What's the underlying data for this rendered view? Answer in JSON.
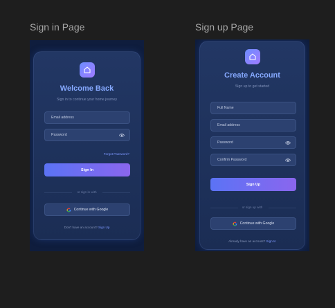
{
  "signin": {
    "frame_title": "Sign in Page",
    "heading": "Welcome Back",
    "subheading": "Sign in to continue your home journey",
    "email_placeholder": "Email address",
    "password_placeholder": "Password",
    "forgot": "Forgot Password?",
    "submit": "Sign In",
    "divider": "or sign in with",
    "google": "Continue with Google",
    "footer_prefix": "Don't have an account?",
    "footer_link": "Sign Up"
  },
  "signup": {
    "frame_title": "Sign up Page",
    "heading": "Create Account",
    "subheading": "Sign up to get started",
    "fullname_placeholder": "Full Name",
    "email_placeholder": "Email address",
    "password_placeholder": "Password",
    "confirm_placeholder": "Confirm Password",
    "submit": "Sign Up",
    "divider": "or sign up with",
    "google": "Continue with Google",
    "footer_prefix": "Already have an account?",
    "footer_link": "Sign In"
  },
  "icons": {
    "logo": "home-icon",
    "eye": "eye-icon",
    "google": "google-icon"
  },
  "colors": {
    "canvas": "#1e1e1e",
    "frame_bg": "#0f1d3d",
    "card_bg": "#223764",
    "field_bg": "#2c4170",
    "heading": "#86a9ff",
    "accent_start": "#5b73f5",
    "accent_end": "#8a66ee",
    "link": "#7d98ff"
  }
}
